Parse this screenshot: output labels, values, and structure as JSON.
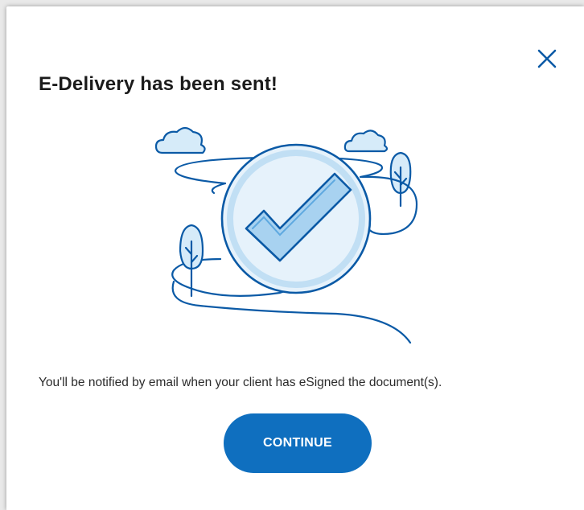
{
  "dialog": {
    "title": "E-Delivery has been sent!",
    "message": "You'll be notified by email when your client has eSigned the document(s).",
    "continue_label": "CONTINUE",
    "close_icon": "close-icon",
    "illustration_icon": "success-checkmark-illustration"
  },
  "colors": {
    "primary": "#0f6fbf",
    "line": "#0b5aa6",
    "light_fill": "#d6ebf9",
    "title_text": "#1b1b1b",
    "body_text": "#2c2c2c"
  }
}
